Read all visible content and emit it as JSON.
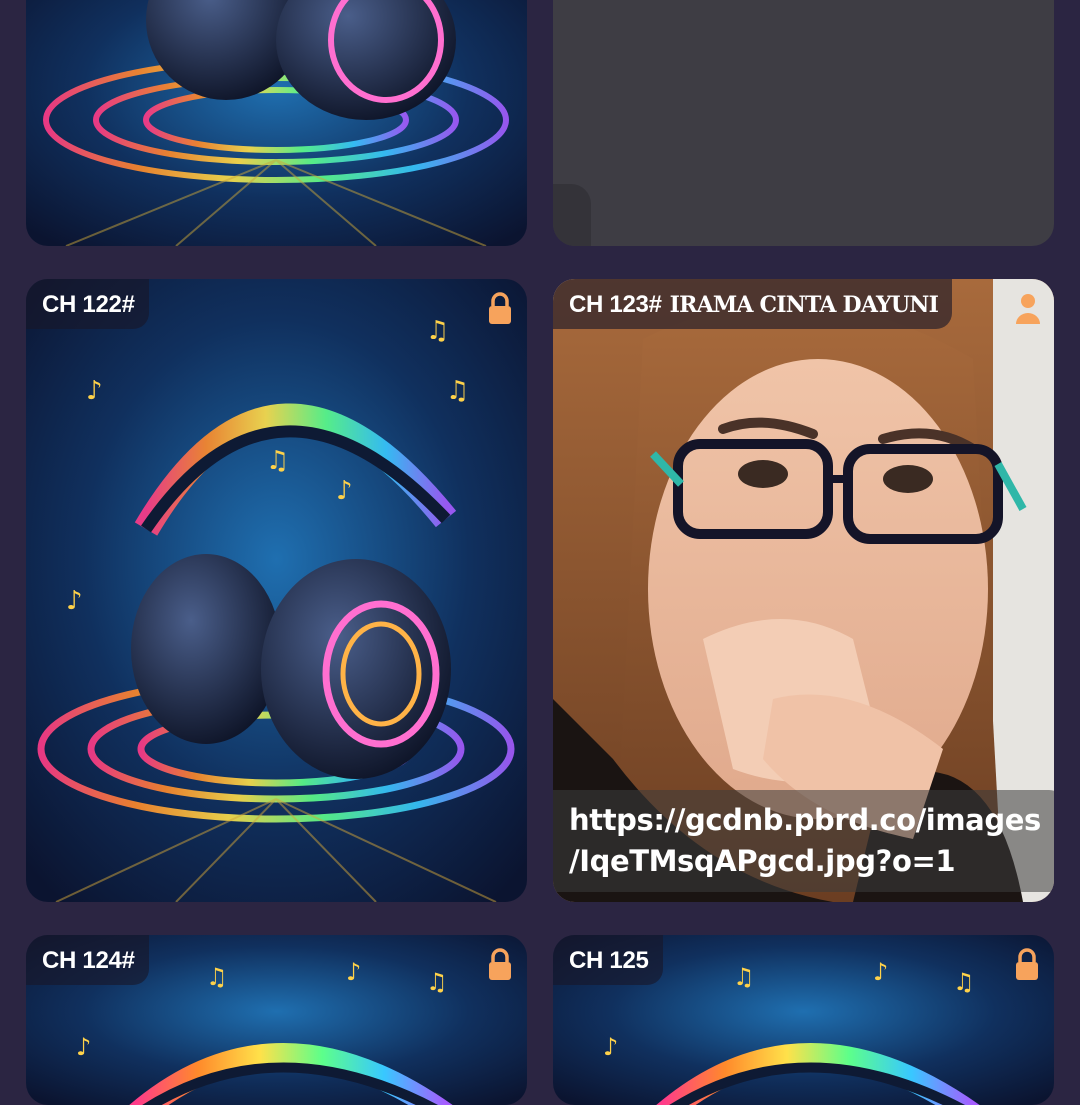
{
  "cards": [
    {
      "title": "",
      "status_icon": "none"
    },
    {
      "title": "",
      "status_icon": "none"
    },
    {
      "title": "CH 122#",
      "subtitle": "",
      "status_icon": "lock-icon"
    },
    {
      "title": "CH 123#",
      "subtitle": "IRAMA CINTA DAYUNI",
      "status_icon": "user-icon",
      "caption_line1": "https://gcdnb.pbrd.co/images",
      "caption_line2": "/IqeTMsqAPgcd.jpg?o=1"
    },
    {
      "title": "CH 124#",
      "subtitle": "",
      "status_icon": "lock-icon"
    },
    {
      "title": "CH 125",
      "subtitle": "",
      "status_icon": "lock-icon"
    }
  ],
  "colors": {
    "background": "#2b2542",
    "accent_icon": "#f7a35c",
    "placeholder": "#3e3d44"
  }
}
